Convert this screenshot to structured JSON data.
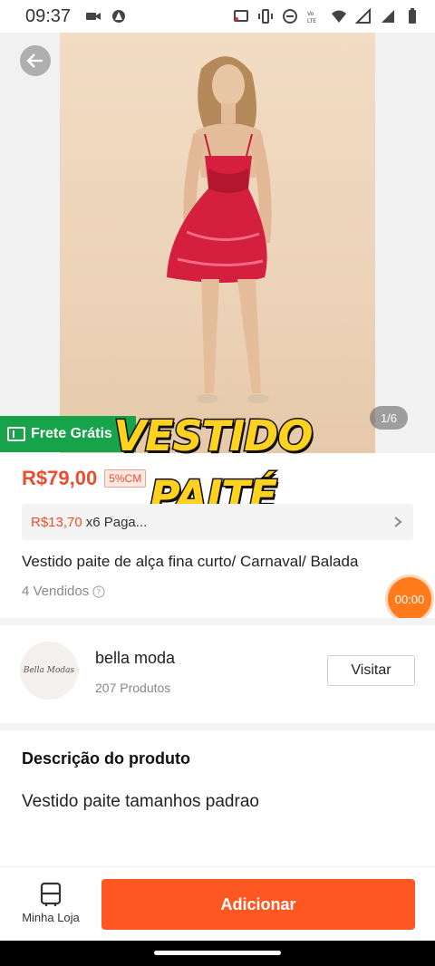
{
  "status_bar": {
    "time": "09:37"
  },
  "hero": {
    "counter": "1/6"
  },
  "badges": {
    "free_shipping": "Frete Grátis"
  },
  "overlay": {
    "line1": "VESTIDO",
    "line2": "PAITÉ"
  },
  "price": {
    "value": "R$79,00",
    "cashback": "5%CM"
  },
  "installment": {
    "price": "R$13,70",
    "text": "x6 Paga..."
  },
  "product": {
    "title": "Vestido paite de alça fina curto/ Carnaval/ Balada",
    "sold": "4 Vendidos"
  },
  "timer": {
    "value": "00:00"
  },
  "shop": {
    "logo_text": "Bella Modas",
    "name": "bella moda",
    "products": "207 Produtos",
    "visit_label": "Visitar"
  },
  "description": {
    "heading": "Descrição do produto",
    "text": "Vestido paite tamanhos padrao"
  },
  "bottom_bar": {
    "my_store_label": "Minha Loja",
    "add_label": "Adicionar"
  },
  "colors": {
    "accent": "#ee4d2d",
    "button": "#ff5722",
    "free_shipping_bg": "#16a34a",
    "caption": "#ffd21f"
  }
}
